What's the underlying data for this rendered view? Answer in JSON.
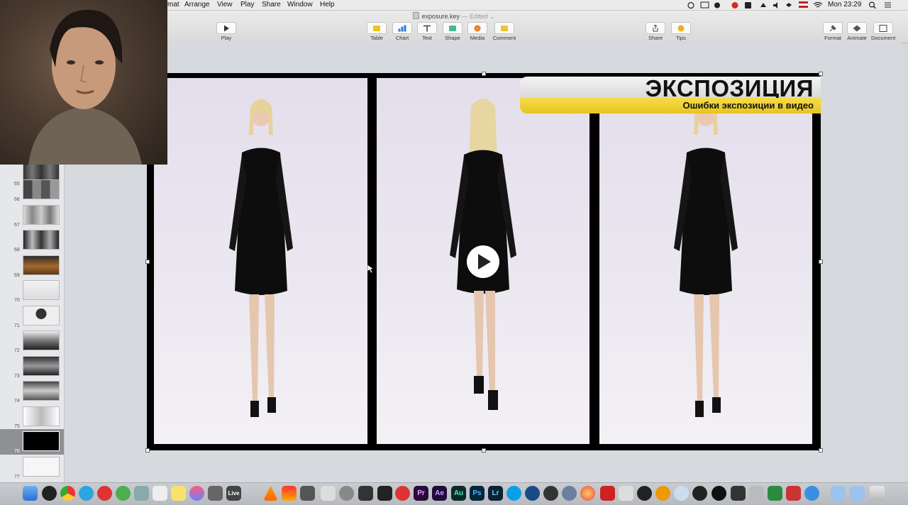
{
  "menu_bar": {
    "items": [
      "mat",
      "Arrange",
      "View",
      "Play",
      "Share",
      "Window",
      "Help"
    ],
    "clock": "Mon 23:29"
  },
  "toolbar": {
    "doc_name": "exposure.key",
    "doc_status": "— Edited",
    "play_label": "Play",
    "insert_buttons": [
      "Table",
      "Chart",
      "Text",
      "Shape",
      "Media",
      "Comment"
    ],
    "share_label": "Share",
    "tips_label": "Tips",
    "right_buttons": [
      "Format",
      "Animate",
      "Document"
    ]
  },
  "sidebar": {
    "slides": [
      {
        "number": "65"
      },
      {
        "number": "66"
      },
      {
        "number": "67"
      },
      {
        "number": "68"
      },
      {
        "number": "69"
      },
      {
        "number": "70"
      },
      {
        "number": "71"
      },
      {
        "number": "72"
      },
      {
        "number": "73"
      },
      {
        "number": "74"
      },
      {
        "number": "75"
      },
      {
        "number": "76"
      },
      {
        "number": "77"
      }
    ],
    "selected_slide": "76"
  },
  "slide": {
    "title": "ЭКСПОЗИЦИЯ",
    "subtitle": "Ошибки экспозиции в видео",
    "banner_colors": {
      "top": "#e6e6e6",
      "bottom": "#f0cf2c"
    }
  },
  "dock": {
    "live_label": "Live",
    "app_labels": [
      "Pr",
      "Ae",
      "Au",
      "Ps",
      "Lr"
    ]
  }
}
